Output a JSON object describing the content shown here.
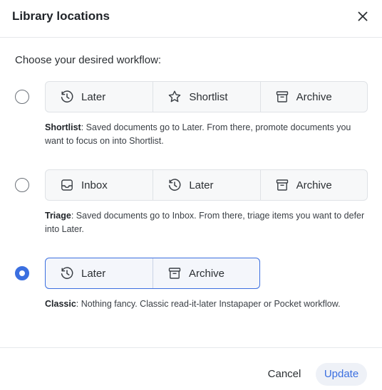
{
  "dialog": {
    "title": "Library locations"
  },
  "prompt": "Choose your desired workflow:",
  "options": [
    {
      "selected": false,
      "locations": [
        {
          "label": "Later",
          "icon": "clock-icon"
        },
        {
          "label": "Shortlist",
          "icon": "star-icon"
        },
        {
          "label": "Archive",
          "icon": "archive-box-icon"
        }
      ],
      "name": "Shortlist",
      "description": ": Saved documents go to Later. From there, promote documents you want to focus on into Shortlist."
    },
    {
      "selected": false,
      "locations": [
        {
          "label": "Inbox",
          "icon": "inbox-tray-icon"
        },
        {
          "label": "Later",
          "icon": "clock-icon"
        },
        {
          "label": "Archive",
          "icon": "archive-box-icon"
        }
      ],
      "name": "Triage",
      "description": ": Saved documents go to Inbox. From there, triage items you want to defer into Later."
    },
    {
      "selected": true,
      "locations": [
        {
          "label": "Later",
          "icon": "clock-icon"
        },
        {
          "label": "Archive",
          "icon": "archive-box-icon"
        }
      ],
      "name": "Classic",
      "description": ": Nothing fancy. Classic read-it-later Instapaper or Pocket workflow."
    }
  ],
  "footer": {
    "cancel_label": "Cancel",
    "update_label": "Update"
  },
  "colors": {
    "accent": "#3b6fe0",
    "border": "#dfe2e6"
  }
}
